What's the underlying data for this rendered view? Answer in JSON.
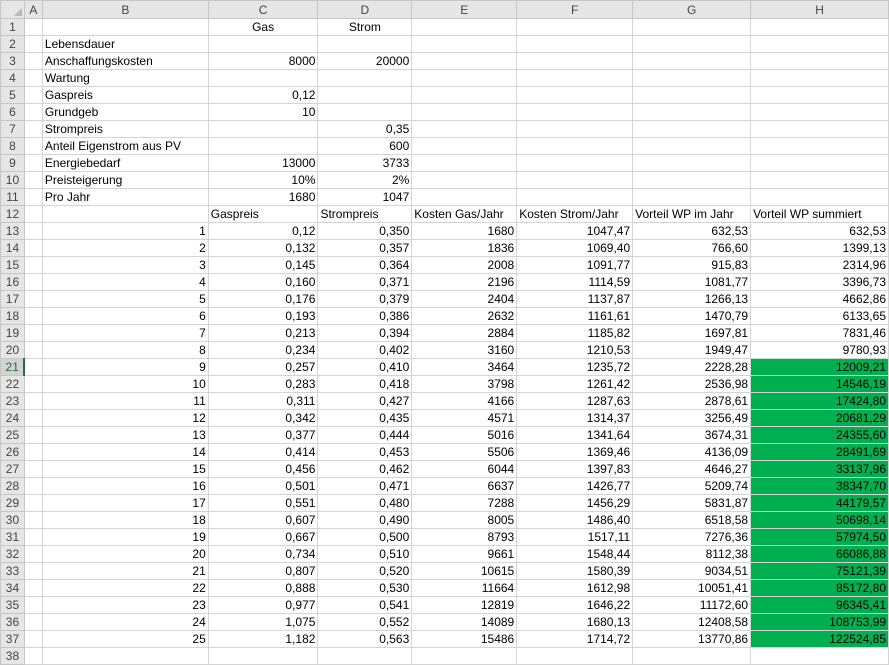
{
  "columns": [
    "A",
    "B",
    "C",
    "D",
    "E",
    "F",
    "G",
    "H"
  ],
  "row_numbers": [
    1,
    2,
    3,
    4,
    5,
    6,
    7,
    8,
    9,
    10,
    11,
    12,
    13,
    14,
    15,
    16,
    17,
    18,
    19,
    20,
    21,
    22,
    23,
    24,
    25,
    26,
    27,
    28,
    29,
    30,
    31,
    32,
    33,
    34,
    35,
    36,
    37,
    38
  ],
  "selected_row": 21,
  "highlight_color": "#00b050",
  "header_row": {
    "gas": "Gas",
    "strom": "Strom"
  },
  "params": [
    {
      "label": "Lebensdauer",
      "gas": "",
      "strom": ""
    },
    {
      "label": "Anschaffungskosten",
      "gas": "8000",
      "strom": "20000"
    },
    {
      "label": "Wartung",
      "gas": "",
      "strom": ""
    },
    {
      "label": "Gaspreis",
      "gas": "0,12",
      "strom": ""
    },
    {
      "label": "Grundgeb",
      "gas": "10",
      "strom": ""
    },
    {
      "label": "Strompreis",
      "gas": "",
      "strom": "0,35"
    },
    {
      "label": "Anteil Eigenstrom aus PV",
      "gas": "",
      "strom": "600"
    },
    {
      "label": "Energiebedarf",
      "gas": "13000",
      "strom": "3733"
    },
    {
      "label": "Preisteigerung",
      "gas": "10%",
      "strom": "2%"
    },
    {
      "label": "Pro Jahr",
      "gas": "1680",
      "strom": "1047"
    }
  ],
  "table_headers": [
    "Gaspreis",
    "Strompreis",
    "Kosten Gas/Jahr",
    "Kosten Strom/Jahr",
    "Vorteil WP im Jahr",
    "Vorteil WP summiert"
  ],
  "table_rows": [
    [
      "1",
      "0,12",
      "0,350",
      "1680",
      "1047,47",
      "632,53",
      "632,53"
    ],
    [
      "2",
      "0,132",
      "0,357",
      "1836",
      "1069,40",
      "766,60",
      "1399,13"
    ],
    [
      "3",
      "0,145",
      "0,364",
      "2008",
      "1091,77",
      "915,83",
      "2314,96"
    ],
    [
      "4",
      "0,160",
      "0,371",
      "2196",
      "1114,59",
      "1081,77",
      "3396,73"
    ],
    [
      "5",
      "0,176",
      "0,379",
      "2404",
      "1137,87",
      "1266,13",
      "4662,86"
    ],
    [
      "6",
      "0,193",
      "0,386",
      "2632",
      "1161,61",
      "1470,79",
      "6133,65"
    ],
    [
      "7",
      "0,213",
      "0,394",
      "2884",
      "1185,82",
      "1697,81",
      "7831,46"
    ],
    [
      "8",
      "0,234",
      "0,402",
      "3160",
      "1210,53",
      "1949,47",
      "9780,93"
    ],
    [
      "9",
      "0,257",
      "0,410",
      "3464",
      "1235,72",
      "2228,28",
      "12009,21"
    ],
    [
      "10",
      "0,283",
      "0,418",
      "3798",
      "1261,42",
      "2536,98",
      "14546,19"
    ],
    [
      "11",
      "0,311",
      "0,427",
      "4166",
      "1287,63",
      "2878,61",
      "17424,80"
    ],
    [
      "12",
      "0,342",
      "0,435",
      "4571",
      "1314,37",
      "3256,49",
      "20681,29"
    ],
    [
      "13",
      "0,377",
      "0,444",
      "5016",
      "1341,64",
      "3674,31",
      "24355,60"
    ],
    [
      "14",
      "0,414",
      "0,453",
      "5506",
      "1369,46",
      "4136,09",
      "28491,69"
    ],
    [
      "15",
      "0,456",
      "0,462",
      "6044",
      "1397,83",
      "4646,27",
      "33137,96"
    ],
    [
      "16",
      "0,501",
      "0,471",
      "6637",
      "1426,77",
      "5209,74",
      "38347,70"
    ],
    [
      "17",
      "0,551",
      "0,480",
      "7288",
      "1456,29",
      "5831,87",
      "44179,57"
    ],
    [
      "18",
      "0,607",
      "0,490",
      "8005",
      "1486,40",
      "6518,58",
      "50698,14"
    ],
    [
      "19",
      "0,667",
      "0,500",
      "8793",
      "1517,11",
      "7276,36",
      "57974,50"
    ],
    [
      "20",
      "0,734",
      "0,510",
      "9661",
      "1548,44",
      "8112,38",
      "66086,88"
    ],
    [
      "21",
      "0,807",
      "0,520",
      "10615",
      "1580,39",
      "9034,51",
      "75121,39"
    ],
    [
      "22",
      "0,888",
      "0,530",
      "11664",
      "1612,98",
      "10051,41",
      "85172,80"
    ],
    [
      "23",
      "0,977",
      "0,541",
      "12819",
      "1646,22",
      "11172,60",
      "96345,41"
    ],
    [
      "24",
      "1,075",
      "0,552",
      "14089",
      "1680,13",
      "12408,58",
      "108753,99"
    ],
    [
      "25",
      "1,182",
      "0,563",
      "15486",
      "1714,72",
      "13770,86",
      "122524,85"
    ]
  ]
}
